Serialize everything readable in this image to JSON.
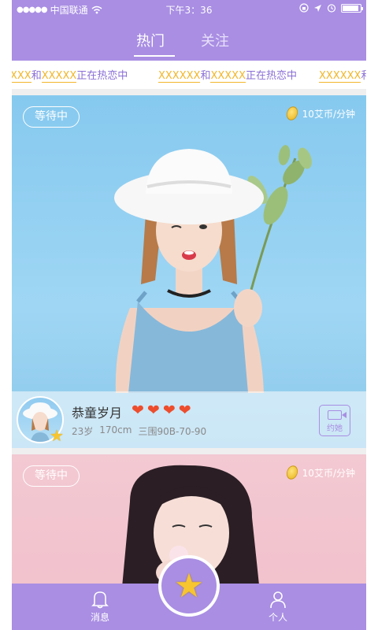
{
  "status_bar": {
    "signal": "●●●●●",
    "carrier": "中国联通",
    "time": "下午3：36"
  },
  "tabs": [
    {
      "label": "热门",
      "active": true
    },
    {
      "label": "关注",
      "active": false
    }
  ],
  "marquee": [
    {
      "name1": "XXX",
      "joiner": "和",
      "name2": "XXXXX",
      "text": "正在热恋中"
    },
    {
      "name1": "XXXXXX",
      "joiner": "和",
      "name2": "XXXXX",
      "text": "正在热恋中"
    },
    {
      "name1": "XXXXXX",
      "joiner": "和",
      "name2": "",
      "text": ""
    }
  ],
  "cards": [
    {
      "status": "等待中",
      "price": "10艾币/分钟",
      "name": "恭童岁月",
      "hearts": 4,
      "age": "23岁",
      "height": "170cm",
      "measurements": "三围90B-70-90",
      "action_label": "约她"
    },
    {
      "status": "等待中",
      "price": "10艾币/分钟"
    }
  ],
  "bottom_bar": {
    "messages_label": "消息",
    "profile_label": "个人"
  },
  "colors": {
    "brand": "#a98ee3",
    "highlight": "#f2b62a",
    "heart": "#ee4d2d"
  }
}
